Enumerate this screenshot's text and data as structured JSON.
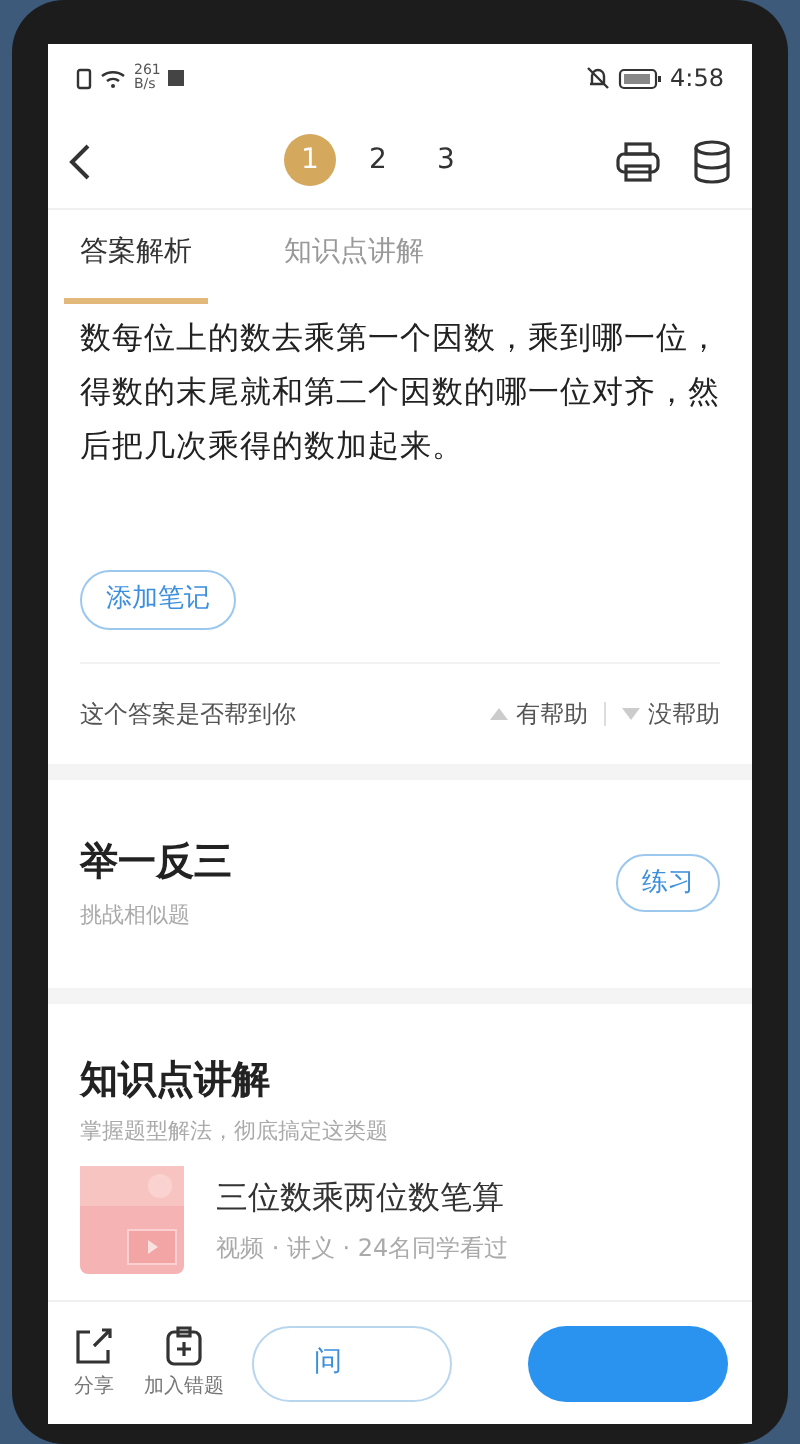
{
  "status_bar": {
    "speed": "261",
    "speed_unit": "B/s",
    "time": "4:58"
  },
  "pages": [
    {
      "label": "1",
      "selected": true
    },
    {
      "label": "2",
      "selected": false
    },
    {
      "label": "3",
      "selected": false
    }
  ],
  "tabs": [
    {
      "label": "答案解析",
      "selected": true
    },
    {
      "label": "知识点讲解",
      "selected": false
    }
  ],
  "answer_text": "数每位上的数去乘第一个因数，乘到哪一位，得数的末尾就和第二个因数的哪一位对齐，然后把几次乘得的数加起来。",
  "add_note": "添加笔记",
  "feedback": {
    "question": "这个答案是否帮到你",
    "helpful": "有帮助",
    "unhelpful": "没帮助"
  },
  "practice": {
    "title": "举一反三",
    "subtitle": "挑战相似题",
    "button": "练习"
  },
  "knowledge": {
    "title": "知识点讲解",
    "subtitle": "掌握题型解法，彻底搞定这类题",
    "items": [
      {
        "kind": "picture",
        "title": "三位数乘两位数笔算",
        "meta": "视频 · 讲义 · 24名同学看过"
      }
    ]
  },
  "bottom_bar": {
    "actions": [
      {
        "kind": "share",
        "label": "分享"
      },
      {
        "kind": "add",
        "label": "加入错题"
      }
    ],
    "ask_button": "问"
  }
}
